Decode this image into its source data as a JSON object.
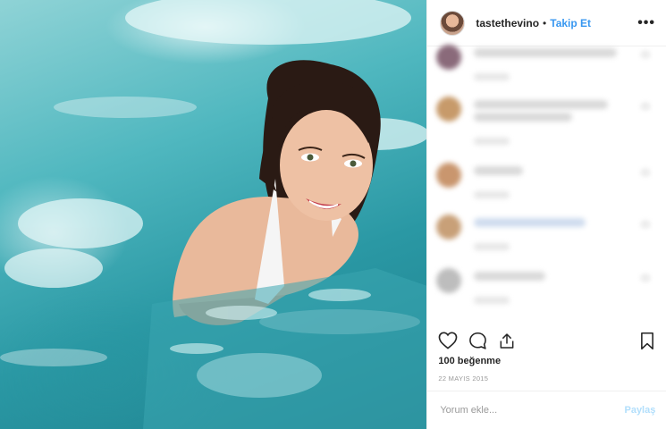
{
  "post": {
    "username": "tastethevino",
    "separator": "•",
    "follow_label": "Takip Et",
    "more_icon": "more-options-icon",
    "likes": "100 beğenme",
    "date": "22 MAYIS 2015"
  },
  "actions": {
    "like_icon": "heart-icon",
    "comment_icon": "comment-icon",
    "share_icon": "share-icon",
    "save_icon": "bookmark-icon"
  },
  "comment_box": {
    "placeholder": "Yorum ekle...",
    "submit_label": "Paylaş"
  },
  "colors": {
    "link": "#3897f0",
    "submit_disabled": "#b2dffc",
    "border": "#efefef"
  }
}
